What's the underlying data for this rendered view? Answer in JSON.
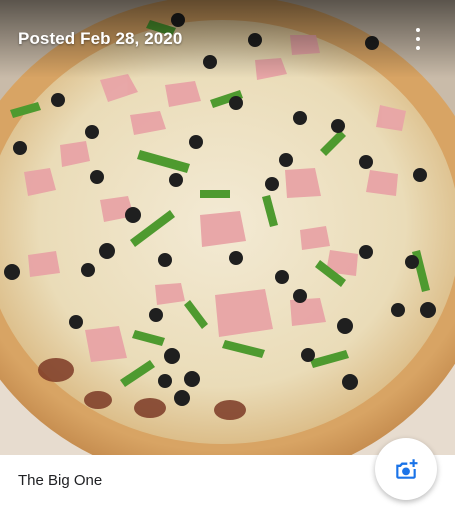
{
  "header": {
    "posted_label": "Posted Feb 28, 2020",
    "more_icon": "more-vert-icon"
  },
  "photo": {
    "subject": "pizza-photo"
  },
  "caption": {
    "title": "The Big One"
  },
  "actions": {
    "add_photo_icon": "add-photo-camera-icon"
  },
  "colors": {
    "accent": "#1a73e8",
    "caption_text": "#202124",
    "header_text": "#ffffff"
  }
}
